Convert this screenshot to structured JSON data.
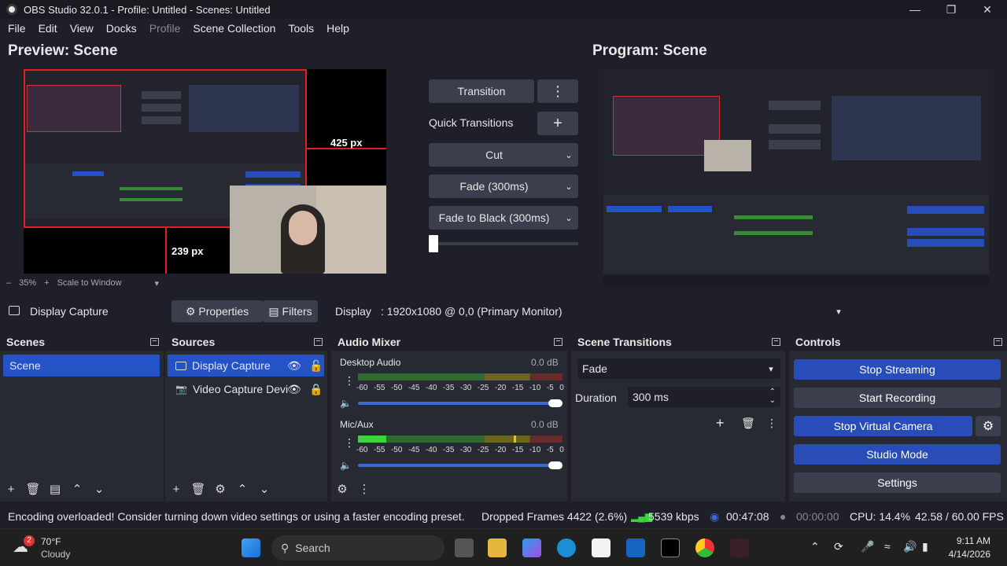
{
  "window": {
    "title": "OBS Studio 32.0.1 - Profile: Untitled - Scenes: Untitled"
  },
  "menu": [
    "File",
    "Edit",
    "View",
    "Docks",
    "Profile",
    "Scene Collection",
    "Tools",
    "Help"
  ],
  "preview": {
    "title": "Preview: Scene",
    "width_label": "425 px",
    "height_label": "239 px",
    "zoom": "35%",
    "scale_mode": "Scale to Window"
  },
  "program": {
    "title": "Program: Scene"
  },
  "transitions_panel": {
    "transition_btn": "Transition",
    "quick_transitions": "Quick Transitions",
    "items": [
      "Cut",
      "Fade (300ms)",
      "Fade to Black (300ms)"
    ],
    "tbar_level": 0.0
  },
  "source_toolbar": {
    "source_name": "Display Capture",
    "properties": "Properties",
    "filters": "Filters",
    "display_label": "Display",
    "display_value": ": 1920x1080 @ 0,0 (Primary Monitor)"
  },
  "docks": {
    "scenes": {
      "title": "Scenes",
      "items": [
        "Scene"
      ]
    },
    "sources": {
      "title": "Sources",
      "items": [
        "Display Capture",
        "Video Capture Devi"
      ]
    },
    "audio": {
      "title": "Audio Mixer",
      "channels": [
        {
          "name": "Desktop Audio",
          "db": "0.0 dB",
          "level": 0.0,
          "volume": 1.0
        },
        {
          "name": "Mic/Aux",
          "db": "0.0 dB",
          "level": 0.14,
          "volume": 1.0
        }
      ],
      "ticks": [
        "-60",
        "-55",
        "-50",
        "-45",
        "-40",
        "-35",
        "-30",
        "-25",
        "-20",
        "-15",
        "-10",
        "-5",
        "0"
      ]
    },
    "transitions": {
      "title": "Scene Transitions",
      "selected": "Fade",
      "duration_label": "Duration",
      "duration_value": "300 ms"
    },
    "controls": {
      "title": "Controls",
      "stop_streaming": "Stop Streaming",
      "start_recording": "Start Recording",
      "stop_virtual_camera": "Stop Virtual Camera",
      "studio_mode": "Studio Mode",
      "settings": "Settings"
    }
  },
  "status": {
    "message": "Encoding overloaded! Consider turning down video settings or using a faster encoding preset.",
    "dropped": "Dropped Frames 4422 (2.6%)",
    "bitrate": "5539 kbps",
    "stream_time": "00:47:08",
    "rec_time": "00:00:00",
    "cpu": "CPU: 14.4%",
    "fps": "42.58 / 60.00 FPS"
  },
  "taskbar": {
    "weather_temp": "70°F",
    "weather_desc": "Cloudy",
    "weather_badge": "2",
    "search": "Search",
    "time": "9:11 AM",
    "date": "4/14/2026"
  },
  "colors": {
    "accent": "#284cb8",
    "selection": "#2453c7",
    "red_box": "#e02020",
    "bg": "#1e1f29",
    "dock_bg": "#272a33"
  }
}
